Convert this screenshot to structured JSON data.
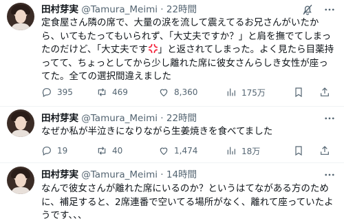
{
  "tweets": [
    {
      "name": "田村芽実",
      "handle": "@Tamura_Meimi",
      "dot": "·",
      "time": "22時間",
      "text_part1": "定食屋さん隣の席で、大量の涙を流して震えてるお兄さんがいたから、いてもたってもいられず、「大丈夫ですか？」と肩を撫でてしまったのだけど、「大丈夫です",
      "text_emoji": "anger-symbol-icon",
      "text_part2": "」と返されてしまった。よく見たら目薬持ってて、ちょっとしてから少し離れた席に彼女さんらしき女性が座ってた。全ての選択間違えました",
      "replies": "395",
      "retweets": "469",
      "likes": "8,360",
      "views": "175万"
    },
    {
      "name": "田村芽実",
      "handle": "@Tamura_Meimi",
      "dot": "·",
      "time": "22時間",
      "text": "なぜか私が半泣きになりながら生姜焼きを食べてました",
      "replies": "19",
      "retweets": "40",
      "likes": "1,474",
      "views": "18万"
    },
    {
      "name": "田村芽実",
      "handle": "@Tamura_Meimi",
      "dot": "·",
      "time": "14時間",
      "text": "なんで彼女さんが離れた席にいるのか？というはてながある方のために、補足すると、2席連番で空いてる場所がなく、離れて座っていたようです、、、"
    }
  ],
  "icons": {
    "mute": "bell-slash-icon",
    "more": "more-icon",
    "reply": "reply-icon",
    "retweet": "retweet-icon",
    "like": "heart-icon",
    "views": "views-icon",
    "bookmark": "bookmark-icon",
    "share": "share-icon"
  },
  "colors": {
    "text": "#0f1419",
    "secondary": "#536471",
    "separator": "#eff3f4",
    "anger": "#f4213a"
  }
}
